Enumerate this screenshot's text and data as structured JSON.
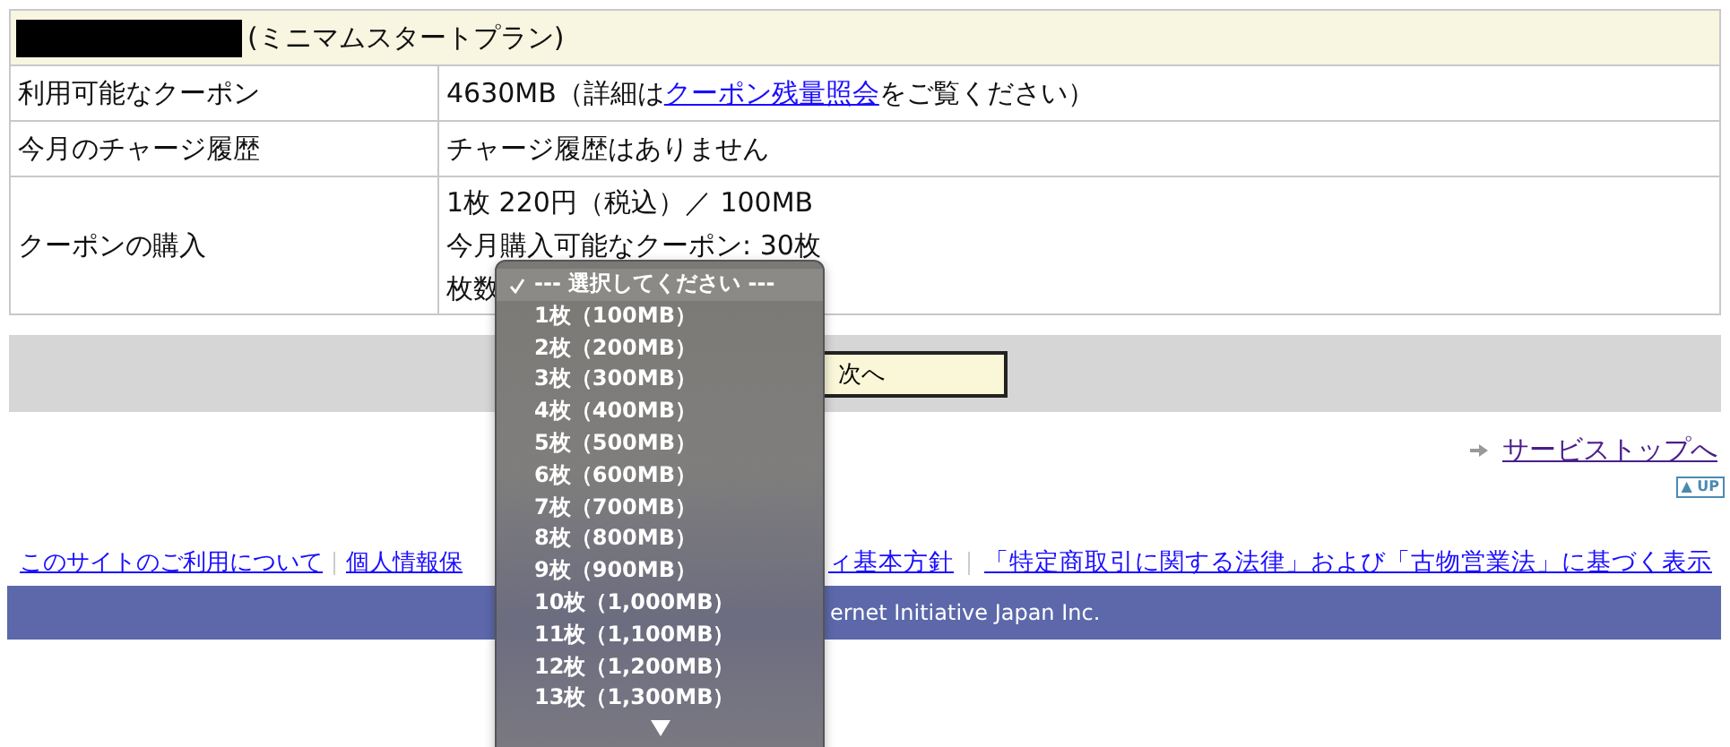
{
  "header": {
    "title": "(ミニマムスタートプラン)"
  },
  "rows": [
    {
      "kind": "link_text",
      "label": "利用可能なクーポン",
      "before": "4630MB（詳細は",
      "link": "クーポン残量照会",
      "after": "をご覧ください）"
    },
    {
      "kind": "text",
      "label": "今月のチャージ履歴",
      "value": "チャージ履歴はありません"
    },
    {
      "kind": "purchase",
      "label": "クーポンの購入",
      "lines": [
        "1枚 220円（税込）／ 100MB",
        "今月購入可能なクーポン: 30枚"
      ],
      "select_label": "枚数"
    }
  ],
  "next_button": "次へ",
  "service_top_link": "サービストップへ",
  "up_button": "▲ UP",
  "footer_links": [
    "このサイトのご利用について",
    "個人情報保",
    "ィ基本方針",
    "「特定商取引に関する法律」および「古物営業法」に基づく表示"
  ],
  "copyright": "ernet Initiative Japan Inc.",
  "dropdown": {
    "items": [
      {
        "label": "--- 選択してください ---",
        "selected": true
      },
      {
        "label": "1枚（100MB）",
        "selected": false
      },
      {
        "label": "2枚（200MB）",
        "selected": false
      },
      {
        "label": "3枚（300MB）",
        "selected": false
      },
      {
        "label": "4枚（400MB）",
        "selected": false
      },
      {
        "label": "5枚（500MB）",
        "selected": false
      },
      {
        "label": "6枚（600MB）",
        "selected": false
      },
      {
        "label": "7枚（700MB）",
        "selected": false
      },
      {
        "label": "8枚（800MB）",
        "selected": false
      },
      {
        "label": "9枚（900MB）",
        "selected": false
      },
      {
        "label": "10枚（1,000MB）",
        "selected": false
      },
      {
        "label": "11枚（1,100MB）",
        "selected": false
      },
      {
        "label": "12枚（1,200MB）",
        "selected": false
      },
      {
        "label": "13枚（1,300MB）",
        "selected": false
      }
    ]
  }
}
